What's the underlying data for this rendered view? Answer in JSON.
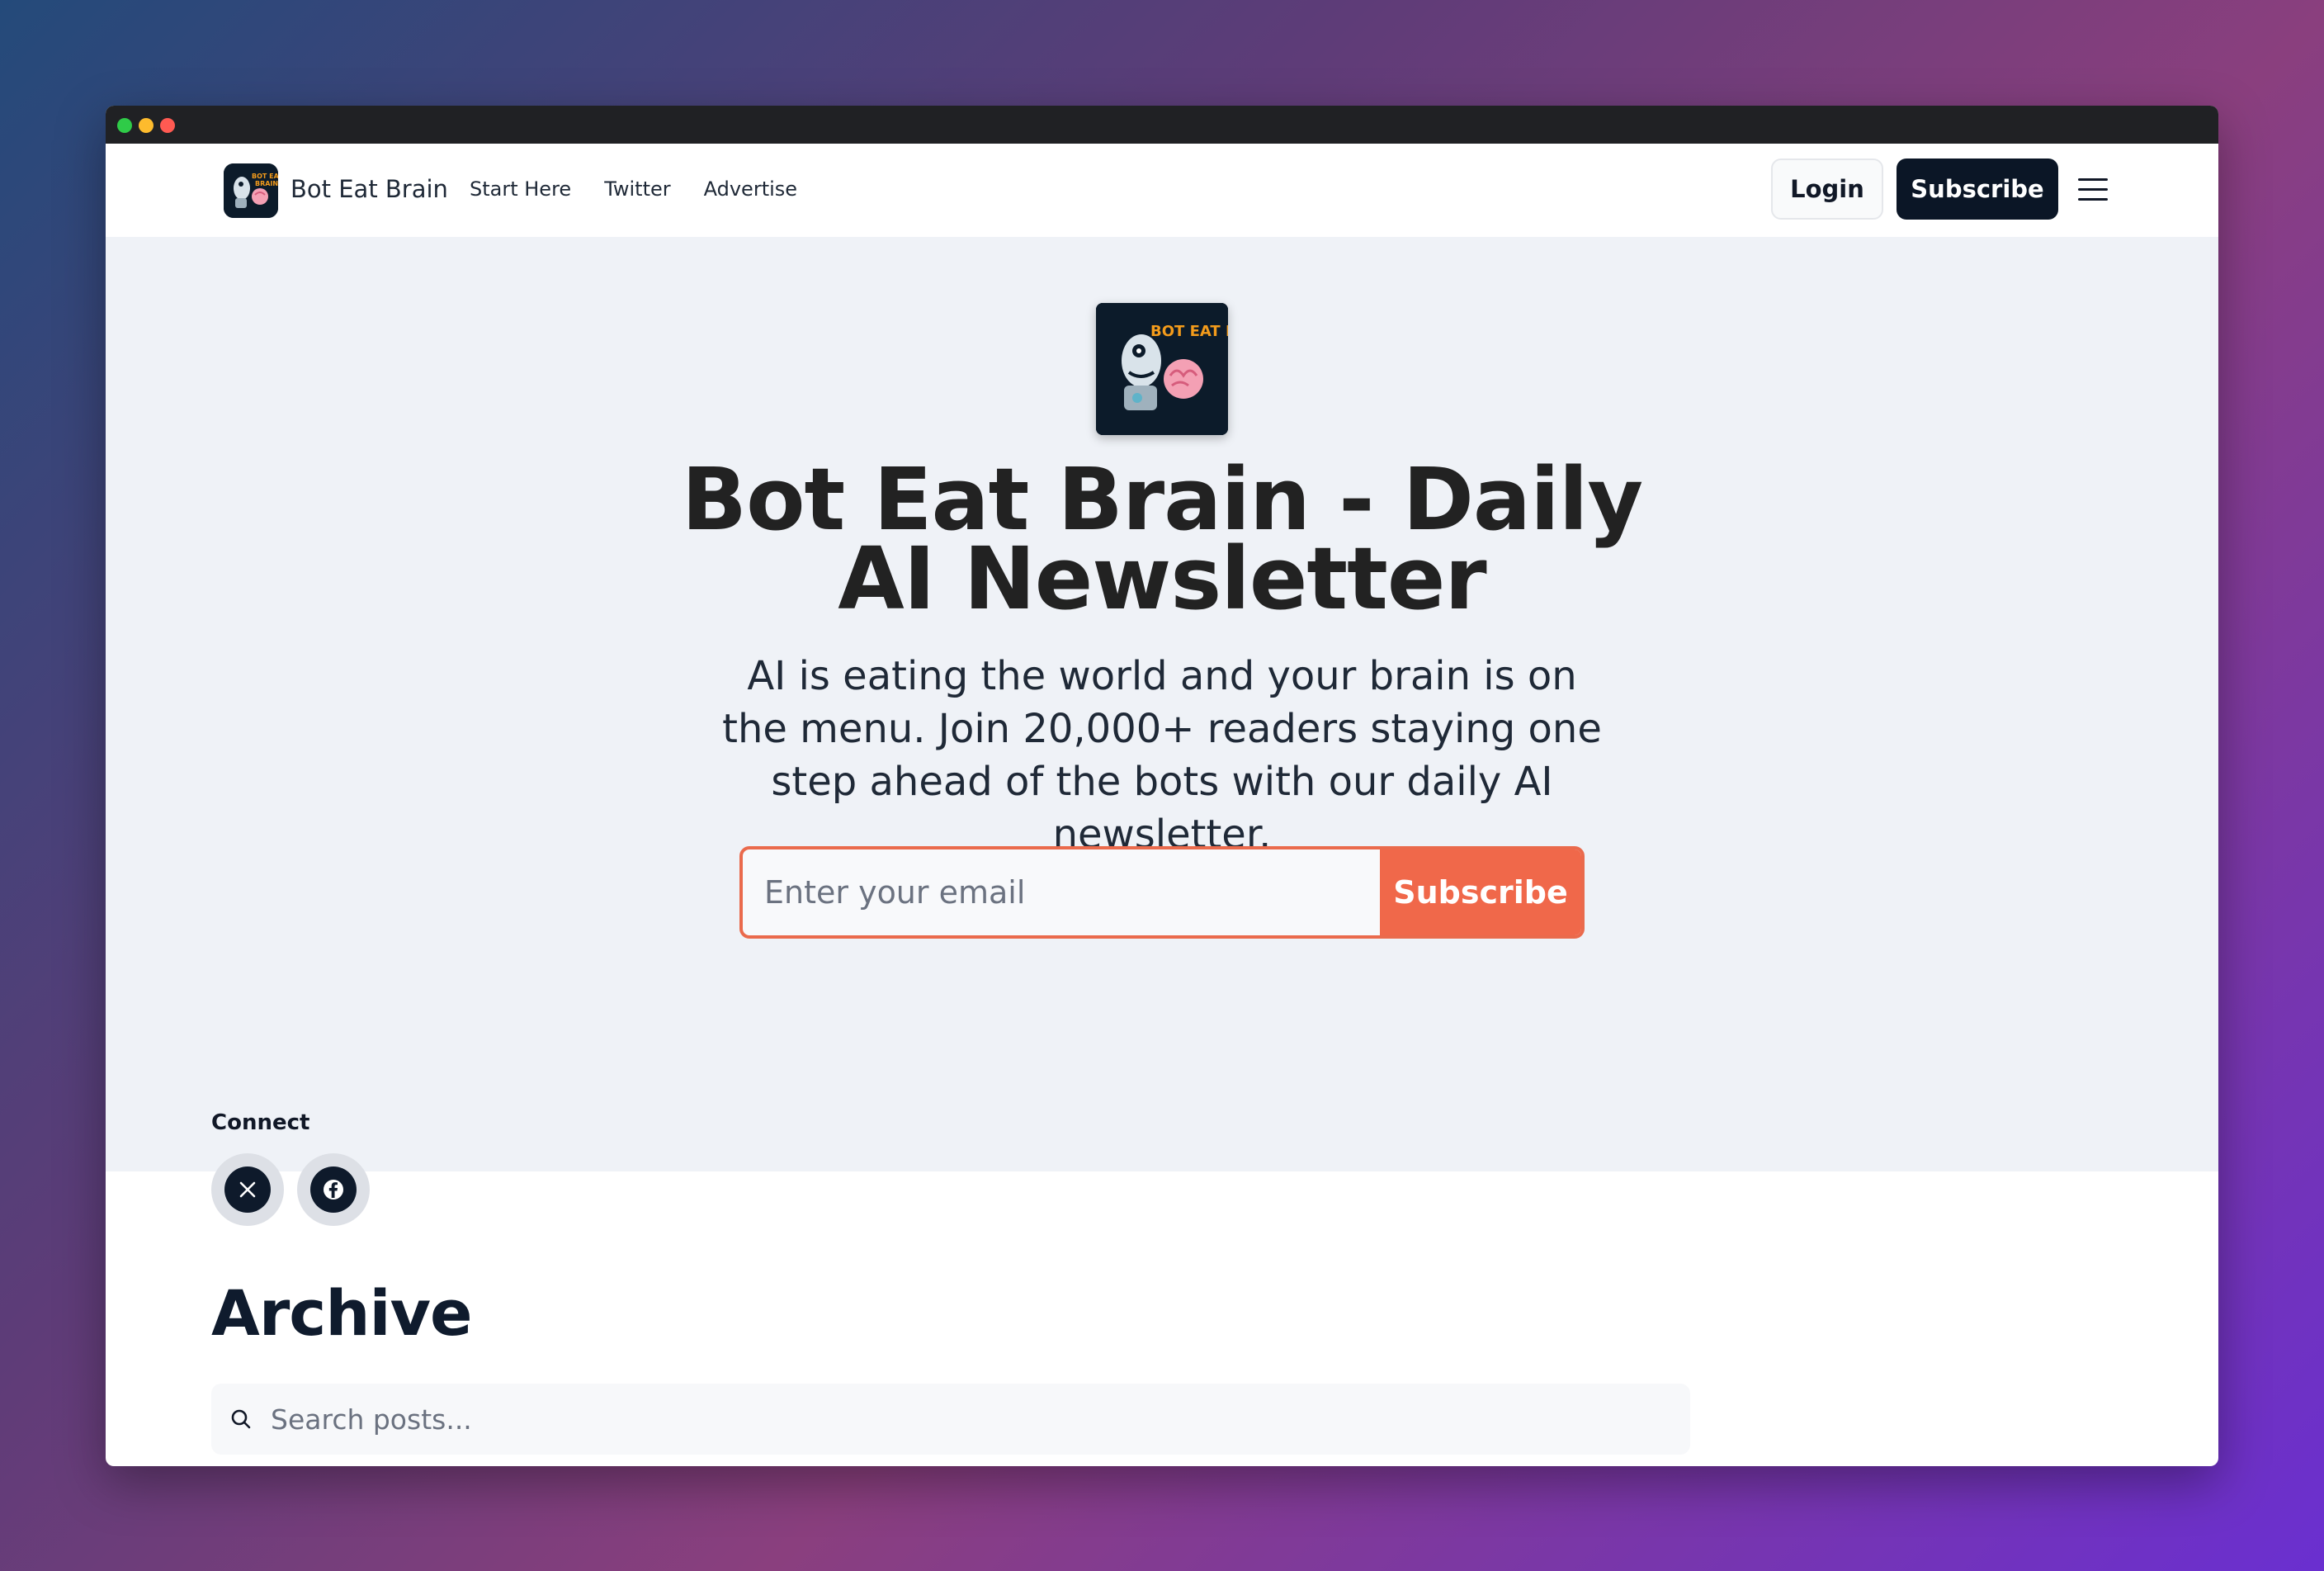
{
  "brand": {
    "name": "Bot Eat Brain",
    "logo_text": "BOT EAT BRAIN"
  },
  "nav": {
    "links": [
      "Start Here",
      "Twitter",
      "Advertise"
    ],
    "login_label": "Login",
    "subscribe_label": "Subscribe"
  },
  "hero": {
    "title": "Bot Eat Brain - Daily AI Newsletter",
    "subtitle": "AI is eating the world and your brain is on the menu. Join 20,000+ readers staying one step ahead of the bots with our daily AI newsletter.",
    "email_placeholder": "Enter your email",
    "subscribe_label": "Subscribe"
  },
  "connect": {
    "label": "Connect",
    "icons": [
      "x-icon",
      "facebook-icon"
    ]
  },
  "archive": {
    "title": "Archive",
    "search_placeholder": "Search posts..."
  },
  "colors": {
    "accent": "#f0684a",
    "dark": "#0b1626",
    "hero_bg": "#eff2f7"
  }
}
